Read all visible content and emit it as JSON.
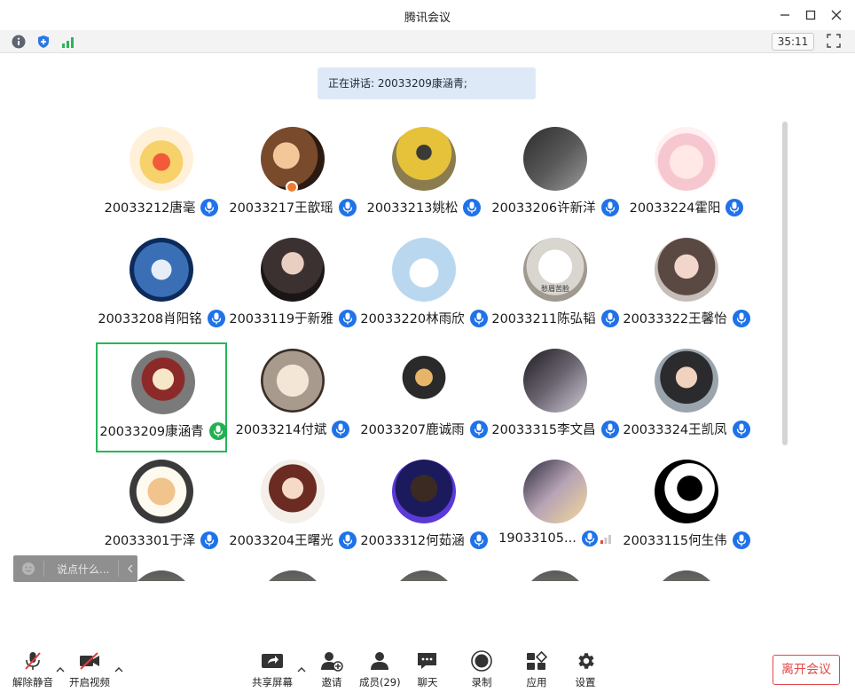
{
  "window": {
    "title": "腾讯会议"
  },
  "toolbar": {
    "timer": "35:11"
  },
  "speaker_banner": "正在讲话: 20033209康涵青;",
  "participants": [
    {
      "name": "20033212唐毫",
      "mic": "on"
    },
    {
      "name": "20033217王歆瑶",
      "mic": "on"
    },
    {
      "name": "20033213姚松",
      "mic": "on"
    },
    {
      "name": "20033206许新洋",
      "mic": "on"
    },
    {
      "name": "20033224霍阳",
      "mic": "on"
    },
    {
      "name": "20033208肖阳铭",
      "mic": "on"
    },
    {
      "name": "20033119于新雅",
      "mic": "on"
    },
    {
      "name": "20033220林雨欣",
      "mic": "on"
    },
    {
      "name": "20033211陈弘韬",
      "mic": "on"
    },
    {
      "name": "20033322王馨怡",
      "mic": "on"
    },
    {
      "name": "20033209康涵青",
      "mic": "speaking"
    },
    {
      "name": "20033214付斌",
      "mic": "on"
    },
    {
      "name": "20033207鹿诚雨",
      "mic": "on"
    },
    {
      "name": "20033315李文昌",
      "mic": "on"
    },
    {
      "name": "20033324王凯凤",
      "mic": "on"
    },
    {
      "name": "20033301于泽",
      "mic": "on"
    },
    {
      "name": "20033204王曙光",
      "mic": "on"
    },
    {
      "name": "20033312何茹涵",
      "mic": "on"
    },
    {
      "name": "19033105...",
      "mic": "signal"
    },
    {
      "name": "20033115何生伟",
      "mic": "on"
    }
  ],
  "avatar_image_text": "愁眉苦脸",
  "chat": {
    "placeholder": "说点什么..."
  },
  "bottom": {
    "unmute": "解除静音",
    "video": "开启视频",
    "share": "共享屏幕",
    "invite": "邀请",
    "members": "成员(29)",
    "chat": "聊天",
    "record": "录制",
    "apps": "应用",
    "settings": "设置",
    "leave": "离开会议"
  },
  "colors": {
    "accent": "#1f72e8",
    "speaking": "#21b24f",
    "leave": "#e34747"
  }
}
